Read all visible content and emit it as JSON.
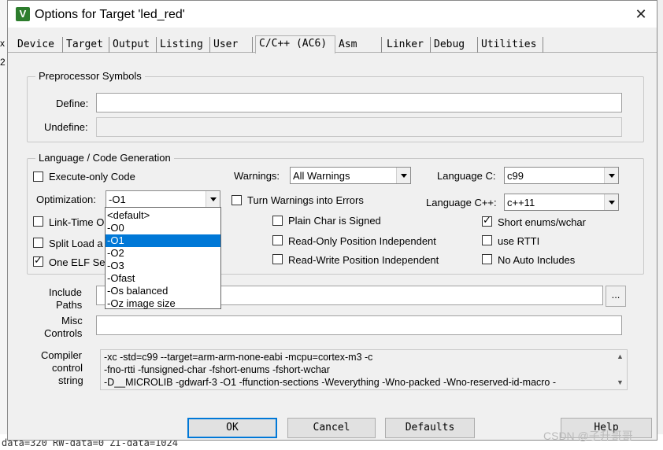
{
  "background": {
    "left_fragments": [
      "x",
      "2"
    ],
    "bottom_line": "data=320 RW-data=0 ZI-data=1024"
  },
  "window": {
    "icon": "keil-uvision-icon",
    "title": "Options for Target 'led_red'",
    "close": "✕"
  },
  "tabs": [
    "Device",
    "Target",
    "Output",
    "Listing",
    "User",
    "C/C++ (AC6)",
    "Asm",
    "Linker",
    "Debug",
    "Utilities"
  ],
  "active_tab": "C/C++ (AC6)",
  "preprocessor": {
    "group_title": "Preprocessor Symbols",
    "define_label": "Define:",
    "define_value": "",
    "undefine_label": "Undefine:",
    "undefine_value": ""
  },
  "language": {
    "group_title": "Language / Code Generation",
    "execute_only": {
      "label": "Execute-only Code",
      "checked": false
    },
    "optimization_label": "Optimization:",
    "optimization_value": "-O1",
    "link_time": {
      "label": "Link-Time O",
      "checked": false
    },
    "split_load": {
      "label": "Split Load a",
      "checked": false
    },
    "one_elf": {
      "label": "One ELF Se",
      "checked": true
    },
    "warnings_label": "Warnings:",
    "warnings_value": "All Warnings",
    "turn_warnings": {
      "label": "Turn Warnings into Errors",
      "checked": false
    },
    "plain_char": {
      "label": "Plain Char is Signed",
      "checked": false
    },
    "read_only_pi": {
      "label": "Read-Only Position Independent",
      "checked": false
    },
    "read_write_pi": {
      "label": "Read-Write Position Independent",
      "checked": false
    },
    "language_c_label": "Language C:",
    "language_c_value": "c99",
    "language_cpp_label": "Language C++:",
    "language_cpp_value": "c++11",
    "short_enums": {
      "label": "Short enums/wchar",
      "checked": true
    },
    "use_rtti": {
      "label": "use RTTI",
      "checked": false
    },
    "no_auto_includes": {
      "label": "No Auto Includes",
      "checked": false
    }
  },
  "optimization_dropdown": {
    "options": [
      "<default>",
      "-O0",
      "-O1",
      "-O2",
      "-O3",
      "-Ofast",
      "-Os balanced",
      "-Oz image size"
    ],
    "selected": "-O1"
  },
  "include_paths": {
    "label_line1": "Include",
    "label_line2": "Paths",
    "value": "",
    "browse": "..."
  },
  "misc_controls": {
    "label_line1": "Misc",
    "label_line2": "Controls",
    "value": ""
  },
  "compiler_control": {
    "label_line1": "Compiler",
    "label_line2": "control",
    "label_line3": "string",
    "lines": [
      "-xc -std=c99 --target=arm-arm-none-eabi -mcpu=cortex-m3 -c",
      "-fno-rtti -funsigned-char -fshort-enums -fshort-wchar",
      "-D__MICROLIB -gdwarf-3 -O1 -ffunction-sections -Weverything -Wno-packed -Wno-reserved-id-macro -"
    ]
  },
  "buttons": {
    "ok": "OK",
    "cancel": "Cancel",
    "defaults": "Defaults",
    "help": "Help"
  },
  "watermark": "CSDN @子升哥哥"
}
